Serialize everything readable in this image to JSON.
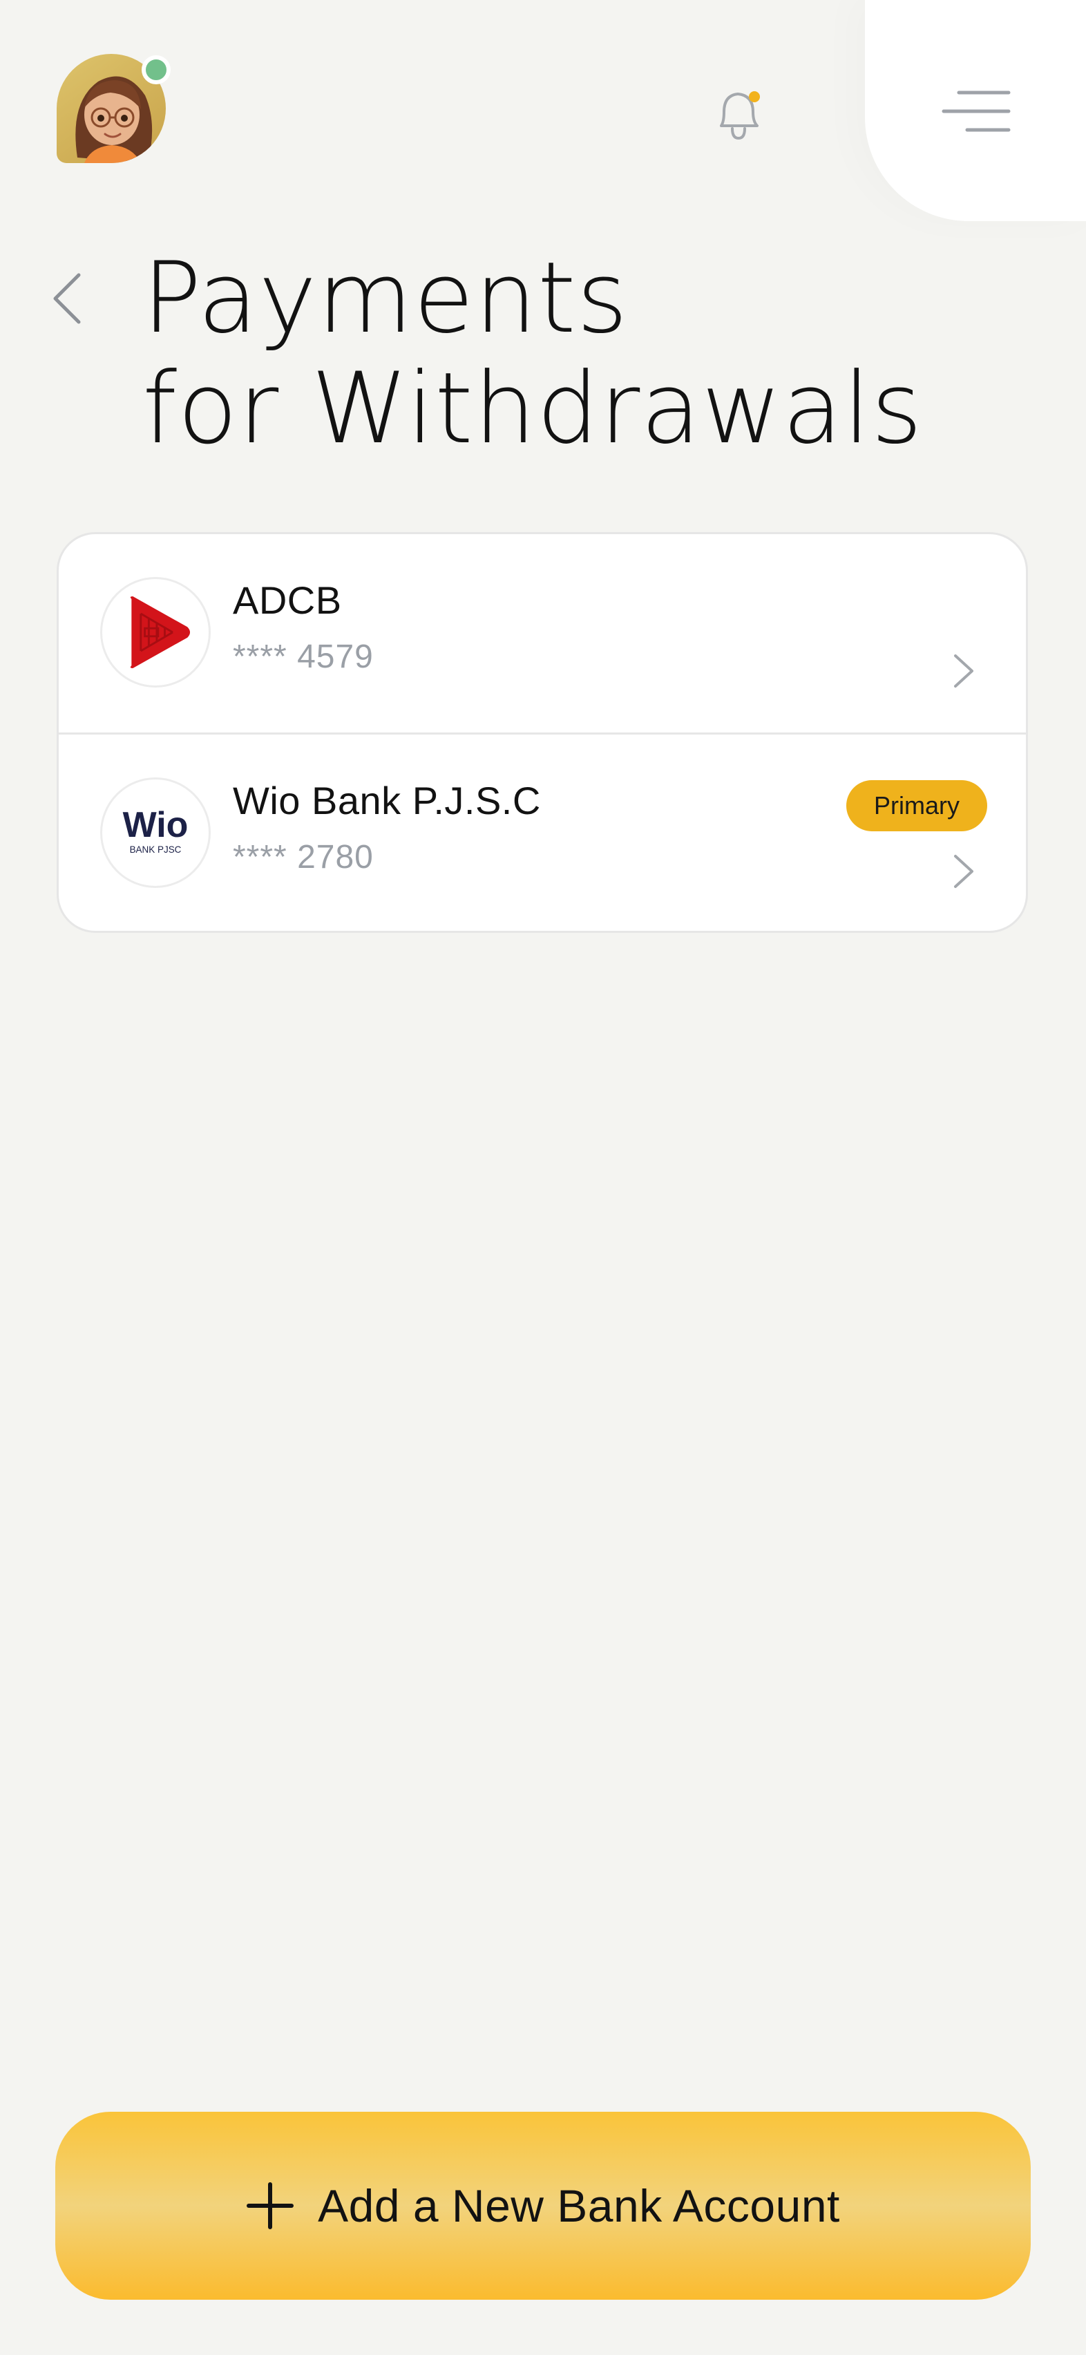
{
  "header": {
    "avatar_icon": "user-avatar-icon",
    "bell_icon": "bell-icon",
    "menu_icon": "menu-icon",
    "status_color": "#72c08b",
    "notification_dot_color": "#f2b21c"
  },
  "page": {
    "title_line1": "Payments",
    "title_line2": "for Withdrawals",
    "back_icon": "chevron-left-icon"
  },
  "accounts": [
    {
      "bank": "ADCB",
      "mask": "****",
      "last4": "4579",
      "logo_icon": "adcb-logo-icon",
      "primary": false
    },
    {
      "bank": "Wio Bank P.J.S.C",
      "mask": "****",
      "last4": "2780",
      "logo_icon": "wio-logo-icon",
      "logo_text": "Wio",
      "logo_subtext": "BANK PJSC",
      "primary": true,
      "badge": "Primary"
    }
  ],
  "actions": {
    "add_account_label": "Add a New Bank Account",
    "add_icon": "plus-icon"
  },
  "colors": {
    "background": "#f4f4f1",
    "accent": "#efb21c",
    "text": "#121212",
    "muted": "#9a9fa6"
  }
}
